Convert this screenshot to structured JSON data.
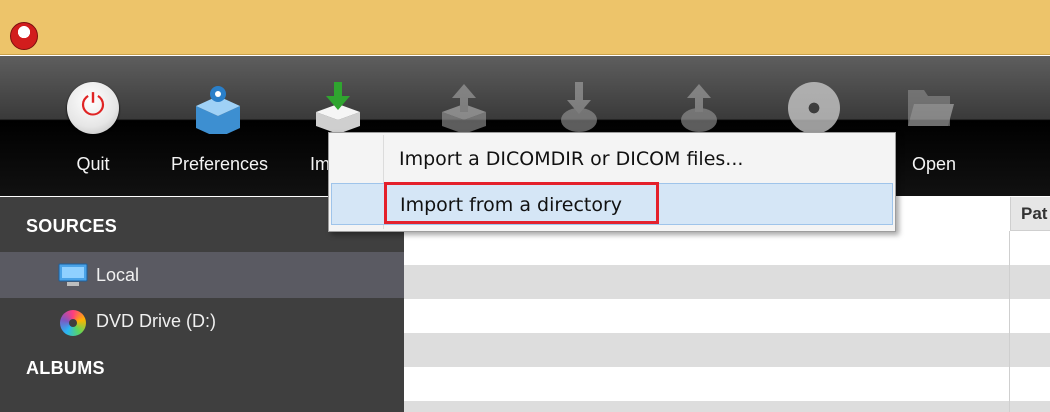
{
  "window": {
    "icon": "app-logo-icon"
  },
  "toolbar": {
    "buttons": [
      {
        "id": "quit",
        "label": "Quit",
        "icon": "power-icon"
      },
      {
        "id": "preferences",
        "label": "Preferences",
        "icon": "gear-box-icon"
      },
      {
        "id": "import",
        "label": "Im",
        "icon": "import-arrow-icon"
      },
      {
        "id": "export",
        "label": "",
        "icon": "export-icon"
      },
      {
        "id": "download",
        "label": "",
        "icon": "download-icon"
      },
      {
        "id": "upload",
        "label": "",
        "icon": "upload-icon"
      },
      {
        "id": "burn",
        "label": "",
        "icon": "disc-icon"
      },
      {
        "id": "open",
        "label": "Open",
        "icon": "folder-icon"
      }
    ]
  },
  "sidebar": {
    "sources_title": "SOURCES",
    "items": [
      {
        "label": "Local",
        "icon": "monitor-icon",
        "selected": true
      },
      {
        "label": "DVD Drive (D:)",
        "icon": "dvd-icon",
        "selected": false
      }
    ],
    "albums_title": "ALBUMS"
  },
  "table": {
    "columns": [
      {
        "label": ""
      },
      {
        "label": "Pat"
      }
    ]
  },
  "menu": {
    "items": [
      {
        "label": "Import a DICOMDIR or DICOM files...",
        "highlighted": false
      },
      {
        "label": "Import from a directory",
        "highlighted": true
      }
    ]
  },
  "colors": {
    "titlebar": "#edc46a",
    "highlight_border": "#e4202b",
    "menu_selected": "#d5e6f6"
  }
}
